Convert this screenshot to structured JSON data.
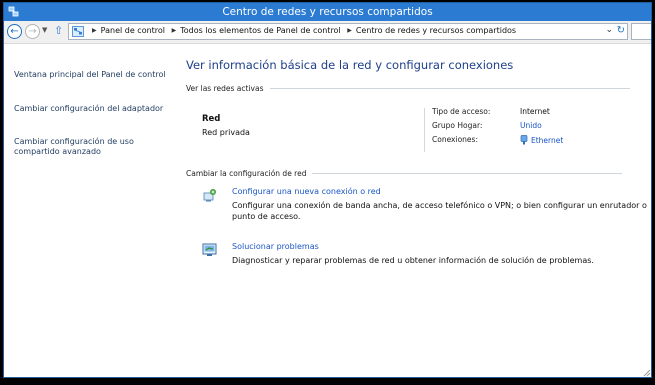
{
  "window": {
    "title": "Centro de redes y recursos compartidos"
  },
  "address": {
    "crumbs": [
      "Panel de control",
      "Todos los elementos de Panel de control",
      "Centro de redes y recursos compartidos"
    ]
  },
  "sidebar": {
    "items": [
      {
        "label": "Ventana principal del Panel de control"
      },
      {
        "label": "Cambiar configuración del adaptador"
      },
      {
        "label": "Cambiar configuración de uso compartido avanzado"
      }
    ]
  },
  "main": {
    "title": "Ver información básica de la red y configurar conexiones",
    "active_networks_label": "Ver las redes activas",
    "network": {
      "name": "Red",
      "type": "Red privada",
      "access_type_label": "Tipo de acceso:",
      "access_type_value": "Internet",
      "homegroup_label": "Grupo Hogar:",
      "homegroup_value": "Unido",
      "connections_label": "Conexiones:",
      "connections_value": "Ethernet"
    },
    "change_settings_label": "Cambiar la configuración de red",
    "tasks": [
      {
        "icon": "new-connection-icon",
        "link": "Configurar una nueva conexión o red",
        "description": "Configurar una conexión de banda ancha, de acceso telefónico o VPN; o bien configurar un enrutador o punto de acceso."
      },
      {
        "icon": "troubleshoot-icon",
        "link": "Solucionar problemas",
        "description": "Diagnosticar y reparar problemas de red u obtener información de solución de problemas."
      }
    ]
  },
  "colors": {
    "titlebar": "#2a7bd1",
    "link": "#1a56c4",
    "title": "#1e3f8a"
  }
}
